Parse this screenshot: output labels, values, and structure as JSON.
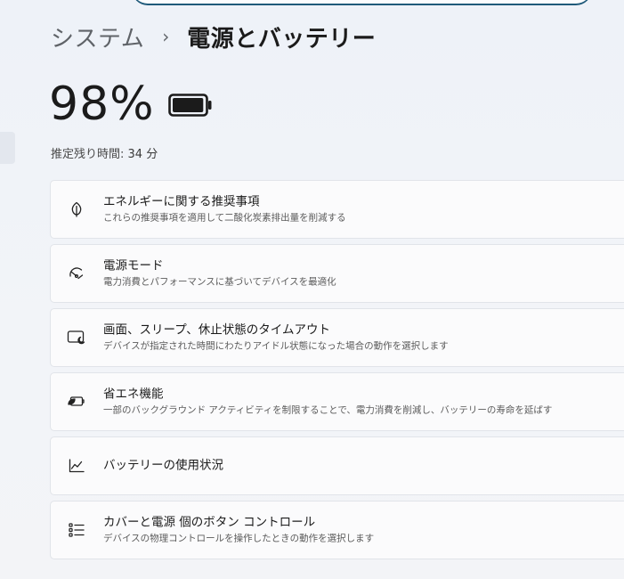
{
  "breadcrumb": {
    "parent": "システム",
    "separator": "›",
    "current": "電源とバッテリー"
  },
  "battery": {
    "percent_label": "98%",
    "level": 0.98,
    "time_label": "推定残り時間:",
    "time_value": "34 分"
  },
  "items": [
    {
      "icon": "leaf-icon",
      "title": "エネルギーに関する推奨事項",
      "description": "これらの推奨事項を適用して二酸化炭素排出量を削減する"
    },
    {
      "icon": "gauge-icon",
      "title": "電源モード",
      "description": "電力消費とパフォーマンスに基づいてデバイスを最適化"
    },
    {
      "icon": "screen-sleep-icon",
      "title": "画面、スリープ、休止状態のタイムアウト",
      "description": "デバイスが指定された時間にわたりアイドル状態になった場合の動作を選択します"
    },
    {
      "icon": "battery-saver-icon",
      "title": "省エネ機能",
      "description": "一部のバックグラウンド アクティビティを制限することで、電力消費を削減し、バッテリーの寿命を延ばす"
    },
    {
      "icon": "usage-chart-icon",
      "title": "バッテリーの使用状況",
      "description": ""
    },
    {
      "icon": "button-list-icon",
      "title": "カバーと電源 個のボタン コントロール",
      "description": "デバイスの物理コントロールを操作したときの動作を選択します"
    }
  ],
  "colors": {
    "background": "#eff3f9",
    "card": "#fbfbfc",
    "text_primary": "#1b1b1b",
    "text_secondary": "#5b5b5b",
    "search_accent": "#1f5a7a"
  }
}
